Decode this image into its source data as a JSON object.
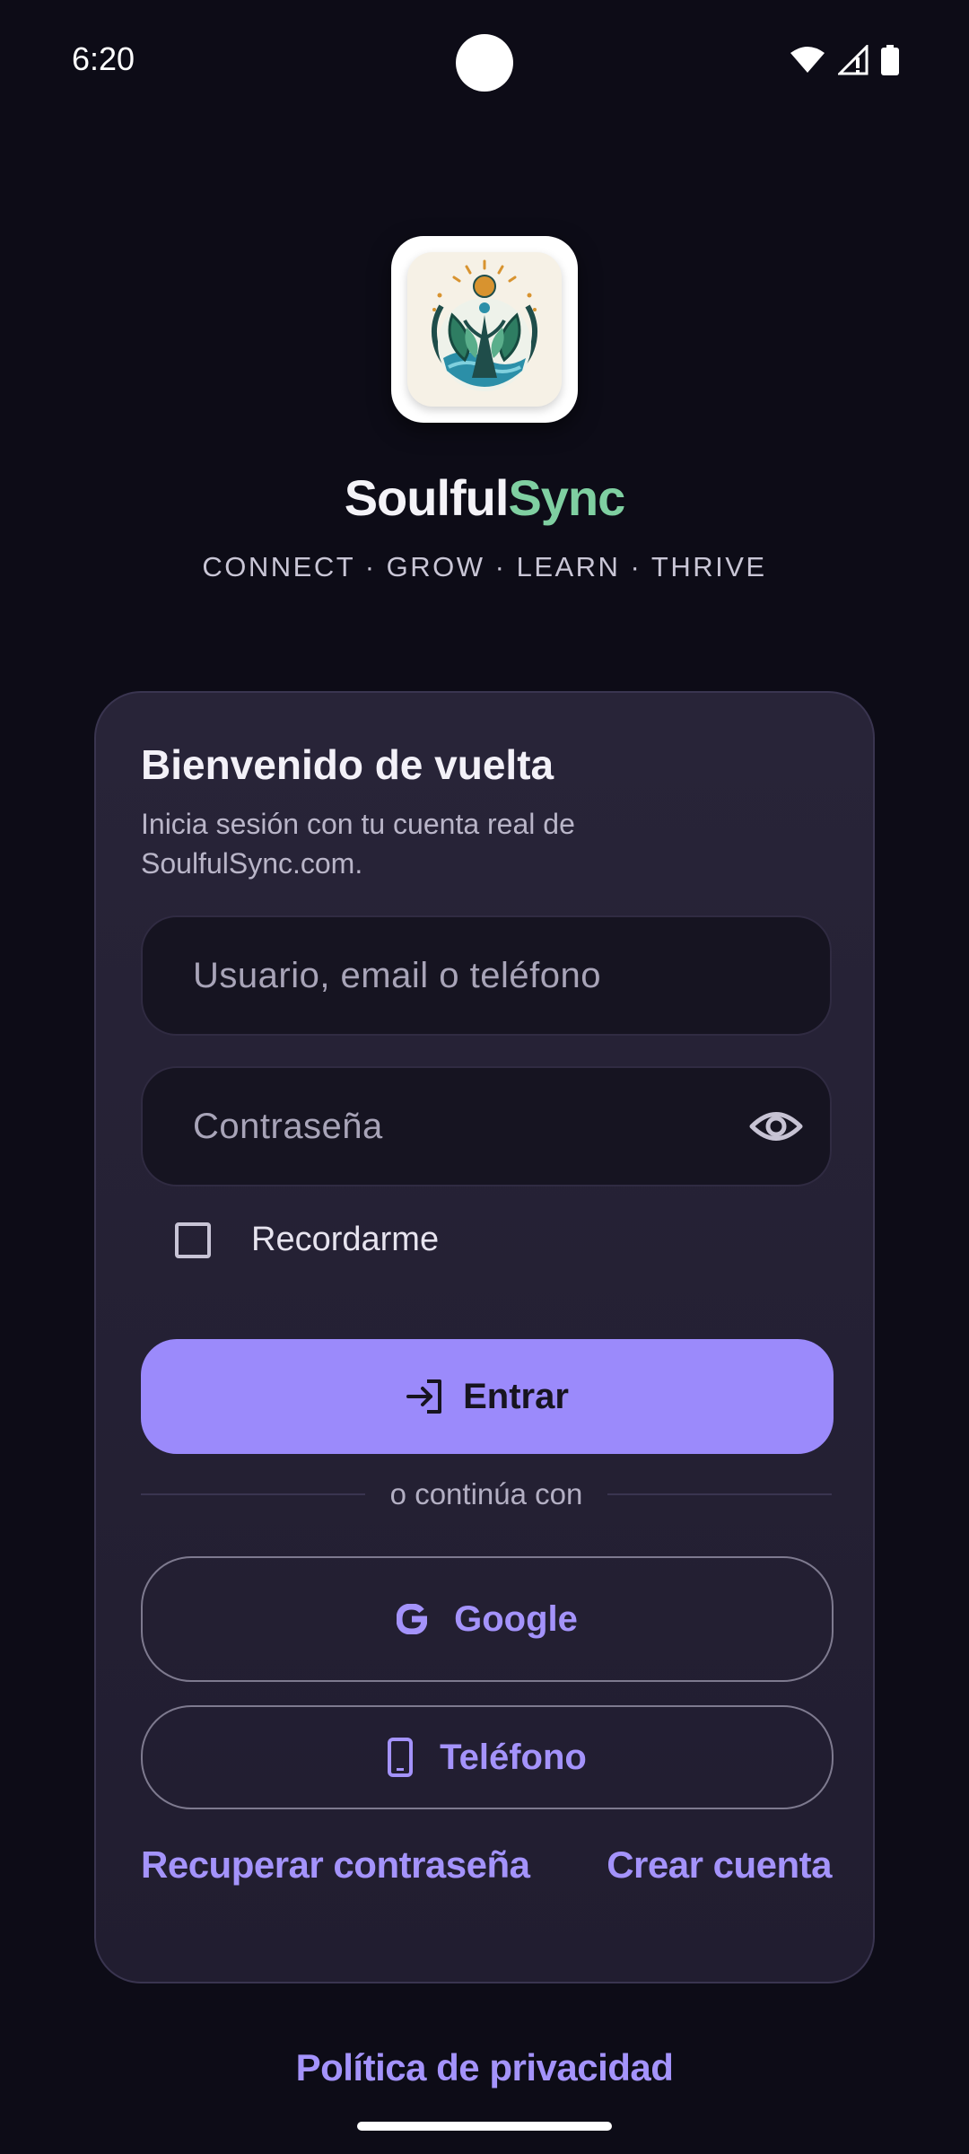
{
  "status_bar": {
    "time": "6:20"
  },
  "brand": {
    "name_part1": "Soulful",
    "name_part2": "Sync",
    "tagline": "CONNECT · GROW · LEARN · THRIVE"
  },
  "login_card": {
    "title": "Bienvenido de vuelta",
    "subtitle": "Inicia sesión con tu cuenta real de SoulfulSync.com.",
    "username_placeholder": "Usuario, email o teléfono",
    "password_placeholder": "Contraseña",
    "remember_label": "Recordarme",
    "remember_checked": false,
    "submit_label": "Entrar",
    "divider_text": "o continúa con",
    "google_label": "Google",
    "phone_label": "Teléfono",
    "recover_link": "Recuperar contraseña",
    "create_link": "Crear cuenta"
  },
  "footer": {
    "privacy_link": "Política de privacidad"
  },
  "colors": {
    "background": "#0d0c17",
    "card": "#262236",
    "accent": "#9b8afb",
    "brand_green": "#7fcfa1"
  },
  "icons": {
    "submit": "login-arrow-icon",
    "google": "google-g-icon",
    "phone": "smartphone-icon",
    "password_toggle": "eye-icon"
  }
}
